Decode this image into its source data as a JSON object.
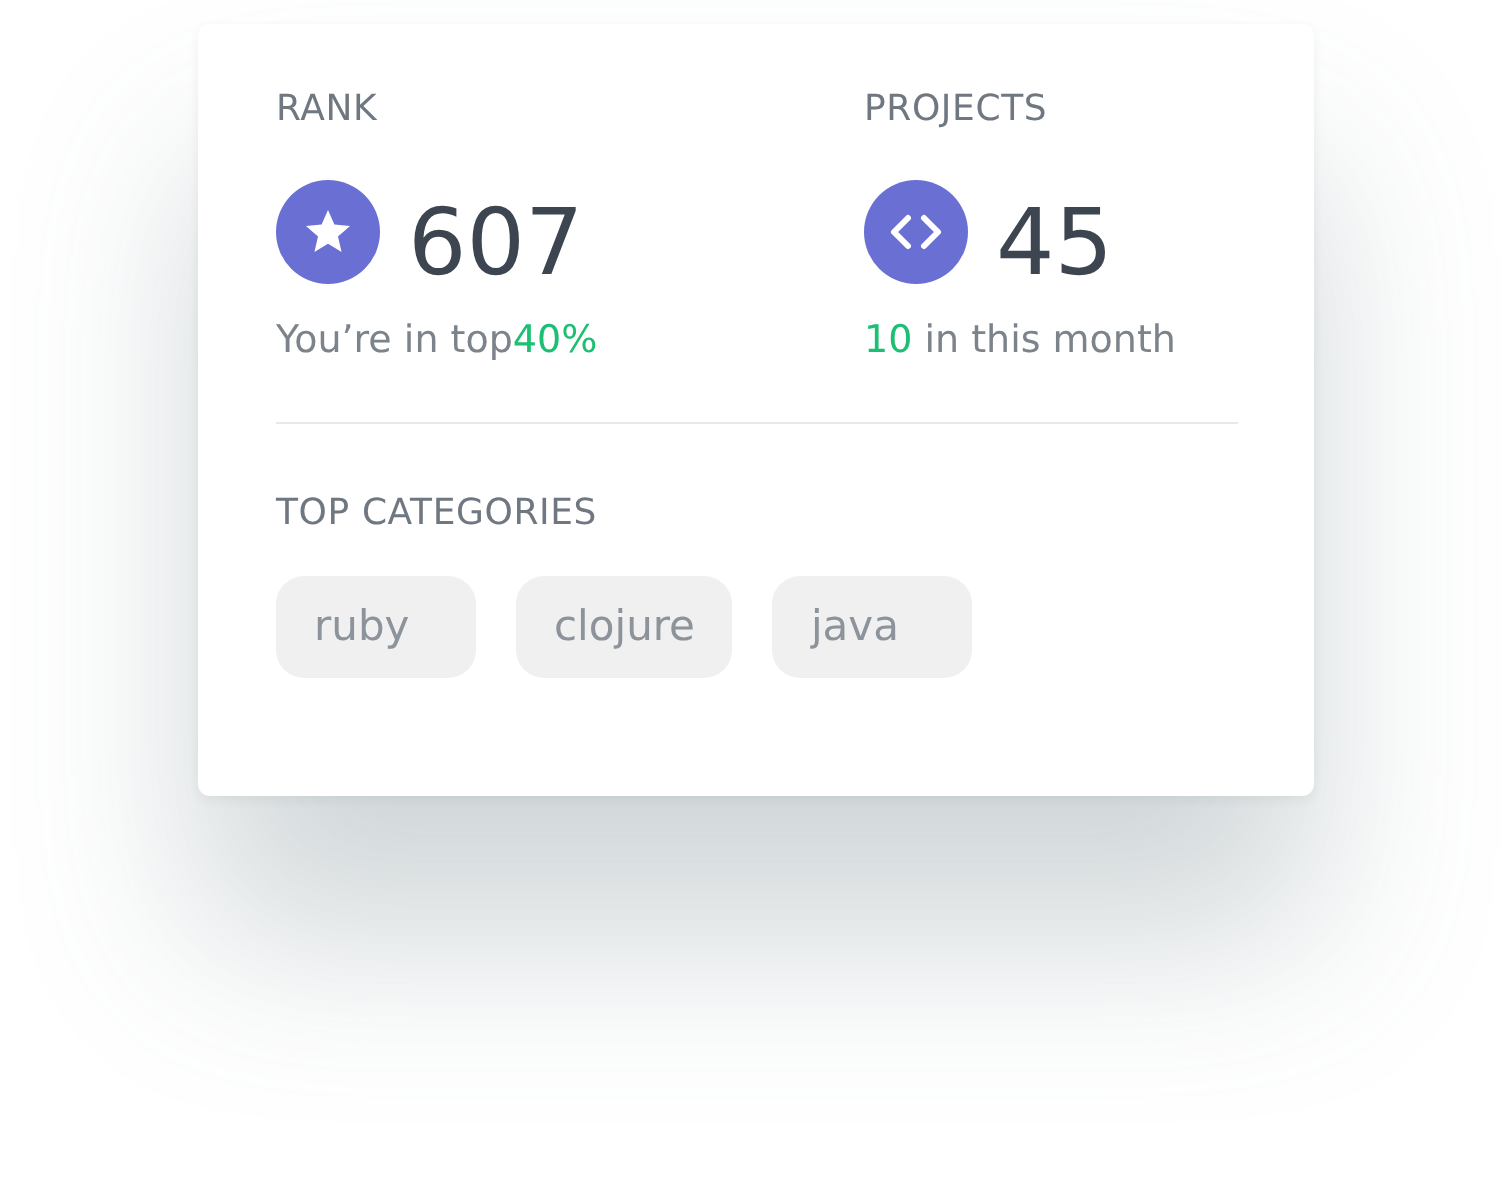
{
  "stats": [
    {
      "label": "RANK",
      "value": "607",
      "note": [
        {
          "text": "You’re in top",
          "highlight": false
        },
        {
          "text": "40%",
          "highlight": true
        }
      ]
    },
    {
      "label": "PROJECTS",
      "value": "45",
      "note": [
        {
          "text": "10",
          "highlight": true
        },
        {
          "text": " in this month",
          "highlight": false
        }
      ]
    }
  ],
  "categories": {
    "label": "TOP CATEGORIES",
    "tags": [
      "ruby",
      "clojure",
      "java"
    ]
  }
}
